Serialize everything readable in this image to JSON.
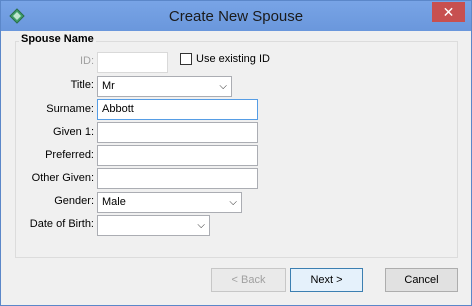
{
  "window": {
    "title": "Create New Spouse",
    "close_glyph": "✕"
  },
  "group": {
    "legend": "Spouse Name"
  },
  "fields": {
    "id": {
      "label": "ID:",
      "value": ""
    },
    "use_existing": {
      "label": "Use existing ID",
      "checked": false
    },
    "title": {
      "label": "Title:",
      "value": "Mr"
    },
    "surname": {
      "label": "Surname:",
      "value": "Abbott"
    },
    "given1": {
      "label": "Given 1:",
      "value": ""
    },
    "preferred": {
      "label": "Preferred:",
      "value": ""
    },
    "other_given": {
      "label": "Other Given:",
      "value": ""
    },
    "gender": {
      "label": "Gender:",
      "value": "Male"
    },
    "dob": {
      "label": "Date of Birth:",
      "value": ""
    }
  },
  "buttons": {
    "back": "< Back",
    "next": "Next >",
    "cancel": "Cancel"
  },
  "icons": {
    "app": "app-diamond-icon",
    "close": "close-icon",
    "dropdown": "chevron-down-icon"
  },
  "colors": {
    "titlebar": "#6d9be0",
    "close": "#c75050",
    "focus_border": "#569de5"
  }
}
